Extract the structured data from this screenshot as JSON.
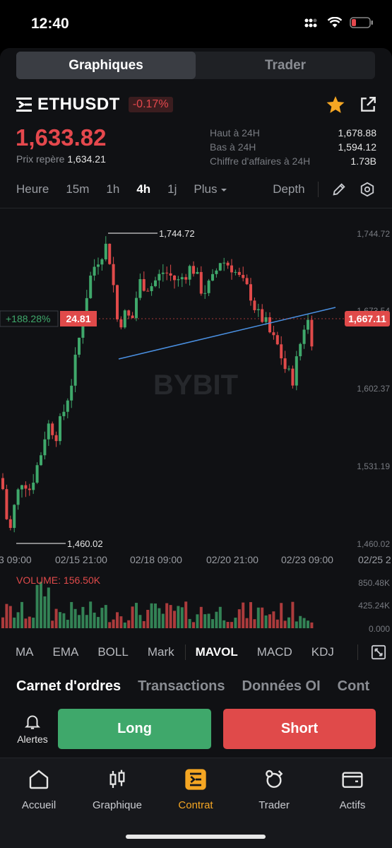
{
  "status": {
    "time": "12:40"
  },
  "segments": [
    {
      "label": "Graphiques",
      "active": true
    },
    {
      "label": "Trader",
      "active": false
    }
  ],
  "ticker": {
    "pair": "ETHUSDT",
    "change": "-0.17%",
    "price": "1,633.82",
    "mark_label": "Prix repère",
    "mark_value": "1,634.21"
  },
  "stats": [
    {
      "label": "Haut à 24H",
      "value": "1,678.88"
    },
    {
      "label": "Bas à 24H",
      "value": "1,594.12"
    },
    {
      "label": "Chiffre d'affaires à 24H",
      "value": "1.73B"
    }
  ],
  "timeframes": {
    "items": [
      "Heure",
      "15m",
      "1h",
      "4h",
      "1j"
    ],
    "active": "4h",
    "more": "Plus",
    "depth": "Depth"
  },
  "chart": {
    "watermark": "BYBIT",
    "high_label": "1,744.72",
    "low_label": "1,460.02",
    "pnl_pct": "+188.28%",
    "position_tag": "24.81",
    "current_price_tag": "1,667.11",
    "y_ticks": [
      "1,744.72",
      "1,673.54",
      "1,602.37",
      "1,531.19",
      "1,460.02"
    ],
    "x_ticks": [
      "3 09:00",
      "02/15 21:00",
      "02/18 09:00",
      "02/20 21:00",
      "02/23 09:00",
      "02/25 2"
    ],
    "volume_label": "VOLUME: 156.50K",
    "vol_ticks": [
      "850.48K",
      "425.24K",
      "0.000"
    ],
    "colors": {
      "up": "#3fa86b",
      "down": "#e04a4a",
      "trend": "#4a90e2"
    }
  },
  "indicators": {
    "items": [
      "MA",
      "EMA",
      "BOLL",
      "Mark",
      "MAVOL",
      "MACD",
      "KDJ"
    ],
    "active": "MAVOL"
  },
  "section_tabs": [
    "Carnet d'ordres",
    "Transactions",
    "Données OI",
    "Cont"
  ],
  "actions": {
    "alerts": "Alertes",
    "long": "Long",
    "short": "Short"
  },
  "nav": [
    {
      "label": "Accueil",
      "icon": "home-icon",
      "active": false
    },
    {
      "label": "Graphique",
      "icon": "candlestick-icon",
      "active": false
    },
    {
      "label": "Contrat",
      "icon": "contract-icon",
      "active": true
    },
    {
      "label": "Trader",
      "icon": "trader-icon",
      "active": false
    },
    {
      "label": "Actifs",
      "icon": "wallet-icon",
      "active": false
    }
  ]
}
